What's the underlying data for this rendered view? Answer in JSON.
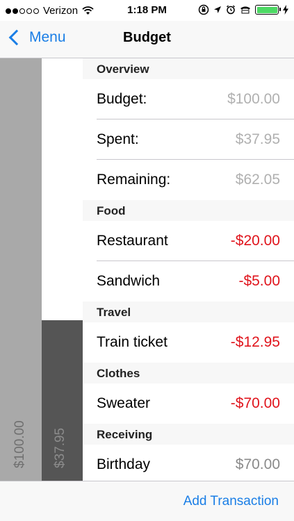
{
  "status_bar": {
    "carrier": "Verizon",
    "time": "1:18 PM",
    "signal_bars_filled": 2,
    "signal_bars_total": 5,
    "battery_color": "#4cd964"
  },
  "nav": {
    "back_label": "Menu",
    "title": "Budget",
    "accent_color": "#1a7ee6"
  },
  "bars": {
    "budget_label": "$100.00",
    "spent_label": "$37.95",
    "spent_fraction": 0.3795
  },
  "sections": {
    "overview": {
      "header": "Overview",
      "rows": [
        {
          "label": "Budget:",
          "value": "$100.00"
        },
        {
          "label": "Spent:",
          "value": "$37.95"
        },
        {
          "label": "Remaining:",
          "value": "$62.05"
        }
      ]
    },
    "food": {
      "header": "Food",
      "rows": [
        {
          "label": "Restaurant",
          "value": "-$20.00"
        },
        {
          "label": "Sandwich",
          "value": "-$5.00"
        }
      ]
    },
    "travel": {
      "header": "Travel",
      "rows": [
        {
          "label": "Train ticket",
          "value": "-$12.95"
        }
      ]
    },
    "clothes": {
      "header": "Clothes",
      "rows": [
        {
          "label": "Sweater",
          "value": "-$70.00"
        }
      ]
    },
    "receiving": {
      "header": "Receiving",
      "rows": [
        {
          "label": "Birthday",
          "value": "$70.00"
        }
      ]
    }
  },
  "toolbar": {
    "add_label": "Add Transaction"
  }
}
